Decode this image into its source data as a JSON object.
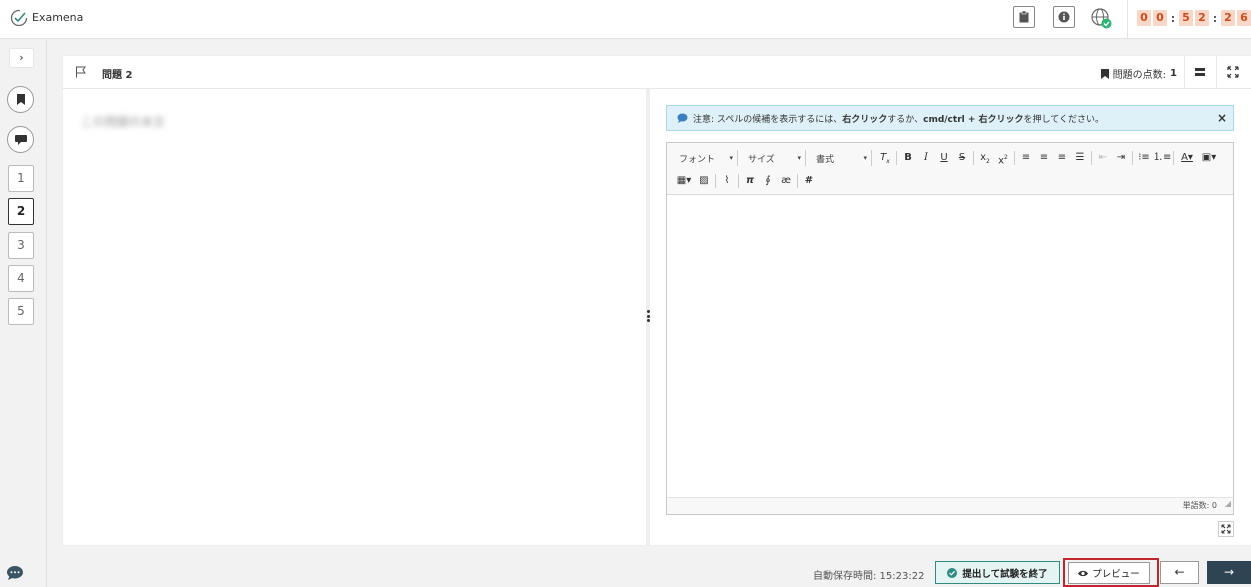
{
  "header": {
    "brand": "Examena",
    "timer": {
      "h1": "0",
      "h2": "0",
      "m1": "5",
      "m2": "2",
      "s1": "2",
      "s2": "6",
      "sep": ":"
    }
  },
  "sidebar": {
    "expand_label": "›",
    "questions": [
      {
        "label": "1"
      },
      {
        "label": "2"
      },
      {
        "label": "3"
      },
      {
        "label": "4"
      },
      {
        "label": "5"
      }
    ],
    "active_question": "2"
  },
  "card": {
    "title": "問題 2",
    "points_label": "問題の点数:",
    "points_value": "1",
    "question_text": "この問題の本文"
  },
  "notice": {
    "prefix": "注意: スペルの候補を表示するには、",
    "right_click": "右クリック",
    "middle": " するか、",
    "combo": "cmd/ctrl + 右クリック",
    "suffix": " を押してください。",
    "close": "×"
  },
  "editor": {
    "font_combo": "フォント",
    "size_combo": "サイズ",
    "format_combo": "書式",
    "word_count": "単語数: 0"
  },
  "footer": {
    "autosave": "自動保存時間: 15:23:22",
    "submit": "提出して試験を終了",
    "preview": "プレビュー",
    "prev": "←",
    "next": "→"
  },
  "colors": {
    "timer_bg": "#f9d7c7",
    "timer_fg": "#d04a1b",
    "notice_bg": "#dff1f8",
    "submit_border": "#2f8b80",
    "next_bg": "#2e4452",
    "highlight": "#c0272d"
  }
}
